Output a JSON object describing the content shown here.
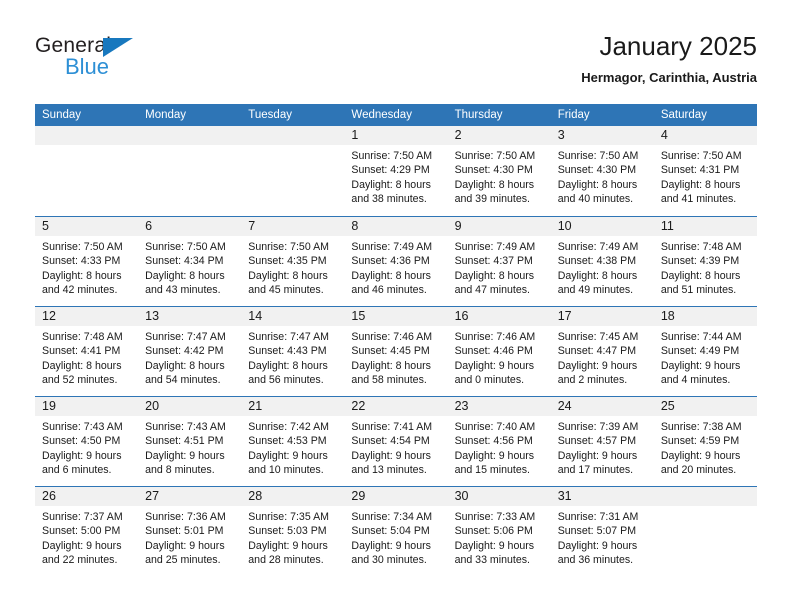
{
  "logo": {
    "text_top": "General",
    "text_bottom": "Blue",
    "triangle_icon": "triangle-icon",
    "color_dark": "#231f20",
    "color_blue": "#2d8fd5"
  },
  "header": {
    "title": "January 2025",
    "subtitle": "Hermagor, Carinthia, Austria"
  },
  "theme": {
    "header_blue": "#2e75b6",
    "day_band_gray": "#f1f1f1",
    "text": "#1a1a1a"
  },
  "weekdays": [
    "Sunday",
    "Monday",
    "Tuesday",
    "Wednesday",
    "Thursday",
    "Friday",
    "Saturday"
  ],
  "weeks": [
    [
      {
        "day": "",
        "empty": true,
        "sunrise": "",
        "sunset": "",
        "daylight_1": "",
        "daylight_2": ""
      },
      {
        "day": "",
        "empty": true,
        "sunrise": "",
        "sunset": "",
        "daylight_1": "",
        "daylight_2": ""
      },
      {
        "day": "",
        "empty": true,
        "sunrise": "",
        "sunset": "",
        "daylight_1": "",
        "daylight_2": ""
      },
      {
        "day": "1",
        "empty": false,
        "sunrise": "Sunrise: 7:50 AM",
        "sunset": "Sunset: 4:29 PM",
        "daylight_1": "Daylight: 8 hours",
        "daylight_2": "and 38 minutes."
      },
      {
        "day": "2",
        "empty": false,
        "sunrise": "Sunrise: 7:50 AM",
        "sunset": "Sunset: 4:30 PM",
        "daylight_1": "Daylight: 8 hours",
        "daylight_2": "and 39 minutes."
      },
      {
        "day": "3",
        "empty": false,
        "sunrise": "Sunrise: 7:50 AM",
        "sunset": "Sunset: 4:30 PM",
        "daylight_1": "Daylight: 8 hours",
        "daylight_2": "and 40 minutes."
      },
      {
        "day": "4",
        "empty": false,
        "sunrise": "Sunrise: 7:50 AM",
        "sunset": "Sunset: 4:31 PM",
        "daylight_1": "Daylight: 8 hours",
        "daylight_2": "and 41 minutes."
      }
    ],
    [
      {
        "day": "5",
        "empty": false,
        "sunrise": "Sunrise: 7:50 AM",
        "sunset": "Sunset: 4:33 PM",
        "daylight_1": "Daylight: 8 hours",
        "daylight_2": "and 42 minutes."
      },
      {
        "day": "6",
        "empty": false,
        "sunrise": "Sunrise: 7:50 AM",
        "sunset": "Sunset: 4:34 PM",
        "daylight_1": "Daylight: 8 hours",
        "daylight_2": "and 43 minutes."
      },
      {
        "day": "7",
        "empty": false,
        "sunrise": "Sunrise: 7:50 AM",
        "sunset": "Sunset: 4:35 PM",
        "daylight_1": "Daylight: 8 hours",
        "daylight_2": "and 45 minutes."
      },
      {
        "day": "8",
        "empty": false,
        "sunrise": "Sunrise: 7:49 AM",
        "sunset": "Sunset: 4:36 PM",
        "daylight_1": "Daylight: 8 hours",
        "daylight_2": "and 46 minutes."
      },
      {
        "day": "9",
        "empty": false,
        "sunrise": "Sunrise: 7:49 AM",
        "sunset": "Sunset: 4:37 PM",
        "daylight_1": "Daylight: 8 hours",
        "daylight_2": "and 47 minutes."
      },
      {
        "day": "10",
        "empty": false,
        "sunrise": "Sunrise: 7:49 AM",
        "sunset": "Sunset: 4:38 PM",
        "daylight_1": "Daylight: 8 hours",
        "daylight_2": "and 49 minutes."
      },
      {
        "day": "11",
        "empty": false,
        "sunrise": "Sunrise: 7:48 AM",
        "sunset": "Sunset: 4:39 PM",
        "daylight_1": "Daylight: 8 hours",
        "daylight_2": "and 51 minutes."
      }
    ],
    [
      {
        "day": "12",
        "empty": false,
        "sunrise": "Sunrise: 7:48 AM",
        "sunset": "Sunset: 4:41 PM",
        "daylight_1": "Daylight: 8 hours",
        "daylight_2": "and 52 minutes."
      },
      {
        "day": "13",
        "empty": false,
        "sunrise": "Sunrise: 7:47 AM",
        "sunset": "Sunset: 4:42 PM",
        "daylight_1": "Daylight: 8 hours",
        "daylight_2": "and 54 minutes."
      },
      {
        "day": "14",
        "empty": false,
        "sunrise": "Sunrise: 7:47 AM",
        "sunset": "Sunset: 4:43 PM",
        "daylight_1": "Daylight: 8 hours",
        "daylight_2": "and 56 minutes."
      },
      {
        "day": "15",
        "empty": false,
        "sunrise": "Sunrise: 7:46 AM",
        "sunset": "Sunset: 4:45 PM",
        "daylight_1": "Daylight: 8 hours",
        "daylight_2": "and 58 minutes."
      },
      {
        "day": "16",
        "empty": false,
        "sunrise": "Sunrise: 7:46 AM",
        "sunset": "Sunset: 4:46 PM",
        "daylight_1": "Daylight: 9 hours",
        "daylight_2": "and 0 minutes."
      },
      {
        "day": "17",
        "empty": false,
        "sunrise": "Sunrise: 7:45 AM",
        "sunset": "Sunset: 4:47 PM",
        "daylight_1": "Daylight: 9 hours",
        "daylight_2": "and 2 minutes."
      },
      {
        "day": "18",
        "empty": false,
        "sunrise": "Sunrise: 7:44 AM",
        "sunset": "Sunset: 4:49 PM",
        "daylight_1": "Daylight: 9 hours",
        "daylight_2": "and 4 minutes."
      }
    ],
    [
      {
        "day": "19",
        "empty": false,
        "sunrise": "Sunrise: 7:43 AM",
        "sunset": "Sunset: 4:50 PM",
        "daylight_1": "Daylight: 9 hours",
        "daylight_2": "and 6 minutes."
      },
      {
        "day": "20",
        "empty": false,
        "sunrise": "Sunrise: 7:43 AM",
        "sunset": "Sunset: 4:51 PM",
        "daylight_1": "Daylight: 9 hours",
        "daylight_2": "and 8 minutes."
      },
      {
        "day": "21",
        "empty": false,
        "sunrise": "Sunrise: 7:42 AM",
        "sunset": "Sunset: 4:53 PM",
        "daylight_1": "Daylight: 9 hours",
        "daylight_2": "and 10 minutes."
      },
      {
        "day": "22",
        "empty": false,
        "sunrise": "Sunrise: 7:41 AM",
        "sunset": "Sunset: 4:54 PM",
        "daylight_1": "Daylight: 9 hours",
        "daylight_2": "and 13 minutes."
      },
      {
        "day": "23",
        "empty": false,
        "sunrise": "Sunrise: 7:40 AM",
        "sunset": "Sunset: 4:56 PM",
        "daylight_1": "Daylight: 9 hours",
        "daylight_2": "and 15 minutes."
      },
      {
        "day": "24",
        "empty": false,
        "sunrise": "Sunrise: 7:39 AM",
        "sunset": "Sunset: 4:57 PM",
        "daylight_1": "Daylight: 9 hours",
        "daylight_2": "and 17 minutes."
      },
      {
        "day": "25",
        "empty": false,
        "sunrise": "Sunrise: 7:38 AM",
        "sunset": "Sunset: 4:59 PM",
        "daylight_1": "Daylight: 9 hours",
        "daylight_2": "and 20 minutes."
      }
    ],
    [
      {
        "day": "26",
        "empty": false,
        "sunrise": "Sunrise: 7:37 AM",
        "sunset": "Sunset: 5:00 PM",
        "daylight_1": "Daylight: 9 hours",
        "daylight_2": "and 22 minutes."
      },
      {
        "day": "27",
        "empty": false,
        "sunrise": "Sunrise: 7:36 AM",
        "sunset": "Sunset: 5:01 PM",
        "daylight_1": "Daylight: 9 hours",
        "daylight_2": "and 25 minutes."
      },
      {
        "day": "28",
        "empty": false,
        "sunrise": "Sunrise: 7:35 AM",
        "sunset": "Sunset: 5:03 PM",
        "daylight_1": "Daylight: 9 hours",
        "daylight_2": "and 28 minutes."
      },
      {
        "day": "29",
        "empty": false,
        "sunrise": "Sunrise: 7:34 AM",
        "sunset": "Sunset: 5:04 PM",
        "daylight_1": "Daylight: 9 hours",
        "daylight_2": "and 30 minutes."
      },
      {
        "day": "30",
        "empty": false,
        "sunrise": "Sunrise: 7:33 AM",
        "sunset": "Sunset: 5:06 PM",
        "daylight_1": "Daylight: 9 hours",
        "daylight_2": "and 33 minutes."
      },
      {
        "day": "31",
        "empty": false,
        "sunrise": "Sunrise: 7:31 AM",
        "sunset": "Sunset: 5:07 PM",
        "daylight_1": "Daylight: 9 hours",
        "daylight_2": "and 36 minutes."
      },
      {
        "day": "",
        "empty": true,
        "sunrise": "",
        "sunset": "",
        "daylight_1": "",
        "daylight_2": ""
      }
    ]
  ]
}
